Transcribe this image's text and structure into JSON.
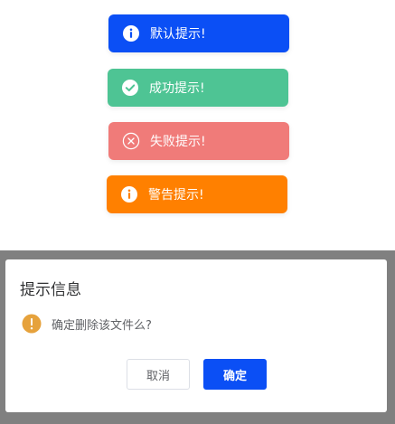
{
  "toasts": {
    "info": {
      "text": "默认提示!",
      "color": "#0b4ff5",
      "icon": "info-icon"
    },
    "success": {
      "text": "成功提示!",
      "color": "#4ec494",
      "icon": "check-circle-icon"
    },
    "error": {
      "text": "失败提示!",
      "color": "#f07b79",
      "icon": "close-circle-icon"
    },
    "warning": {
      "text": "警告提示!",
      "color": "#ff8000",
      "icon": "info-icon"
    }
  },
  "dialog": {
    "title": "提示信息",
    "message": "确定删除该文件么?",
    "message_icon": "warning-icon",
    "warning_color": "#e6a23c",
    "cancel_label": "取消",
    "confirm_label": "确定"
  },
  "colors": {
    "overlay": "#808080",
    "primary": "#0b4ff5"
  }
}
